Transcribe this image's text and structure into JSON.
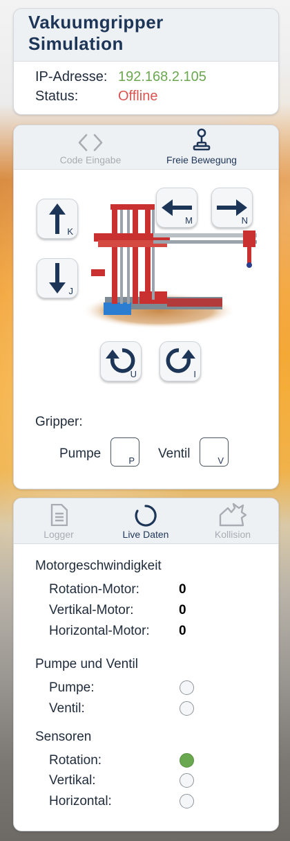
{
  "header": {
    "title_line1": "Vakuumgripper",
    "title_line2": "Simulation",
    "ip_label": "IP-Adresse:",
    "ip_value": "192.168.2.105",
    "status_label": "Status:",
    "status_value": "Offline"
  },
  "control_tabs": {
    "code_label": "Code Eingabe",
    "free_label": "Freie Bewegung",
    "active": "free"
  },
  "controls": {
    "keys": {
      "up": "K",
      "down": "J",
      "left": "M",
      "right": "N",
      "rotate_ccw": "U",
      "rotate_cw": "I"
    },
    "gripper_title": "Gripper:",
    "pump_label": "Pumpe",
    "pump_key": "P",
    "valve_label": "Ventil",
    "valve_key": "V"
  },
  "live_tabs": {
    "logger_label": "Logger",
    "live_label": "Live Daten",
    "collision_label": "Kollision",
    "active": "live"
  },
  "live_data": {
    "motor_title": "Motorgeschwindigkeit",
    "motors": [
      {
        "label": "Rotation-Motor:",
        "value": "0"
      },
      {
        "label": "Vertikal-Motor:",
        "value": "0"
      },
      {
        "label": "Horizontal-Motor:",
        "value": "0"
      }
    ],
    "pump_valve_title": "Pumpe und Ventil",
    "pump_valve": [
      {
        "label": "Pumpe:",
        "on": false
      },
      {
        "label": "Ventil:",
        "on": false
      }
    ],
    "sensors_title": "Sensoren",
    "sensors": [
      {
        "label": "Rotation:",
        "on": true
      },
      {
        "label": "Vertikal:",
        "on": false
      },
      {
        "label": "Horizontal:",
        "on": false
      }
    ]
  },
  "colors": {
    "ip": "#6aa84f",
    "status_offline": "#d9534f",
    "indicator_on": "#6aa84f",
    "title": "#1d3557"
  }
}
